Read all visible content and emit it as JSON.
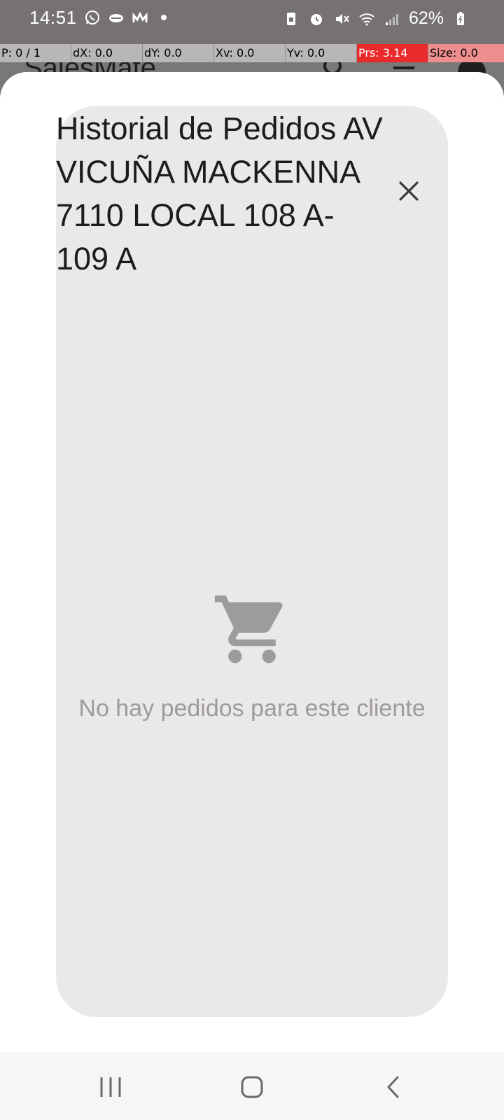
{
  "status_bar": {
    "time": "14:51",
    "battery": "62%",
    "left_icons": [
      "whatsapp-icon",
      "handshake-icon",
      "movistar-icon",
      "dot-icon"
    ],
    "right_icons": [
      "sim-icon",
      "alarm-icon",
      "mute-icon",
      "wifi-icon",
      "signal-icon",
      "battery-icon"
    ]
  },
  "debug_bar": {
    "pointers": "P: 0 / 1",
    "dx": "dX: 0.0",
    "dy": "dY: 0.0",
    "xv": "Xv: 0.0",
    "yv": "Yv: 0.0",
    "prs": "Prs: 3.14",
    "size": "Size: 0.0"
  },
  "background_app": {
    "title": "SalesMate"
  },
  "dialog": {
    "title": "Historial de Pedidos AV VICUÑA MACKENNA 7110 LOCAL 108 A- 109 A",
    "close_icon": "close-icon",
    "empty_icon": "shopping-cart-icon",
    "empty_message": "No hay pedidos para este cliente"
  },
  "nav_bar": {
    "buttons": [
      "recents-icon",
      "home-icon",
      "back-icon"
    ]
  },
  "colors": {
    "scrim": "#7a7777",
    "card_bg": "#ebe8e8",
    "muted_text": "#9e9b9b",
    "prs_highlight": "#ea2a2a"
  }
}
